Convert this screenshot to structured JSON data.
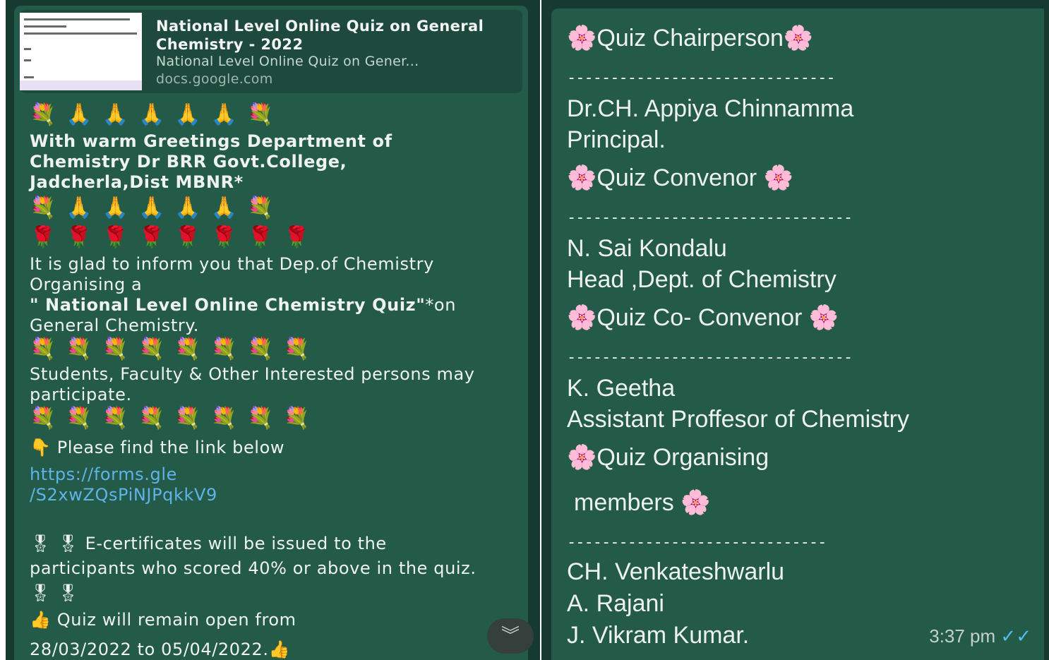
{
  "left": {
    "preview": {
      "title": "National Level Online Quiz on General Chemistry - 2022",
      "description": "National Level Online Quiz on Gener...",
      "domain": "docs.google.com"
    },
    "emoji_row_1": "💐🙏🙏🙏🙏🙏💐",
    "greeting": "With warm Greetings Department of Chemistry Dr BRR Govt.College, Jadcherla,Dist MBNR*",
    "emoji_row_2": "💐🙏🙏🙏🙏🙏💐",
    "emoji_row_3": "🌹🌹🌹🌹🌹🌹🌹🌹",
    "inform_text": "It is glad to inform you that Dep.of Chemistry Organising a",
    "quiz_name": "\" National Level Online Chemistry Quiz\"",
    "quiz_suffix": "*on General Chemistry.",
    "emoji_row_4": "💐💐💐💐💐💐💐💐",
    "participate_text": "Students, Faculty & Other Interested persons may participate.",
    "emoji_row_5": "💐💐💐💐💐💐💐💐",
    "find_link_emoji": "👇",
    "find_link_text": "Please find the link below",
    "link_line_1": "https://forms.gle",
    "link_line_2": "/S2xwZQsPiNJPqkkV9",
    "medal_emoji": "🎖 🎖",
    "certificate_text": "E-certificates will be issued to the participants who scored 40% or above in the quiz.",
    "medal_emoji_end": "🎖 🎖",
    "thumbs_emoji": "👍",
    "open_text": "Quiz will remain open from",
    "date_text": "28/03/2022 to 05/04/2022.",
    "scroll_icon": "chevron-double-down-icon"
  },
  "right": {
    "flower": "🌸",
    "chairperson_heading": "Quiz Chairperson",
    "dashes_1": "-------------------------------",
    "chair_name": "Dr.CH. Appiya Chinnamma",
    "chair_title": "Principal.",
    "convenor_heading": "Quiz Convenor",
    "dashes_2": "---------------------------------",
    "convenor_name": "N. Sai Kondalu",
    "convenor_title": "Head ,Dept. of Chemistry",
    "coconvenor_heading": "Quiz Co- Convenor",
    "dashes_3": "---------------------------------",
    "coconvenor_name": "K. Geetha",
    "coconvenor_title": "Assistant Proffesor of Chemistry",
    "organising_heading": "Quiz Organising",
    "organising_heading_2": "members",
    "dashes_4": "------------------------------",
    "member_1": "CH. Venkateshwarlu",
    "member_2": "A. Rajani",
    "member_3": "J. Vikram Kumar.",
    "timestamp": "3:37 pm",
    "read_icon": "double-check-icon"
  }
}
